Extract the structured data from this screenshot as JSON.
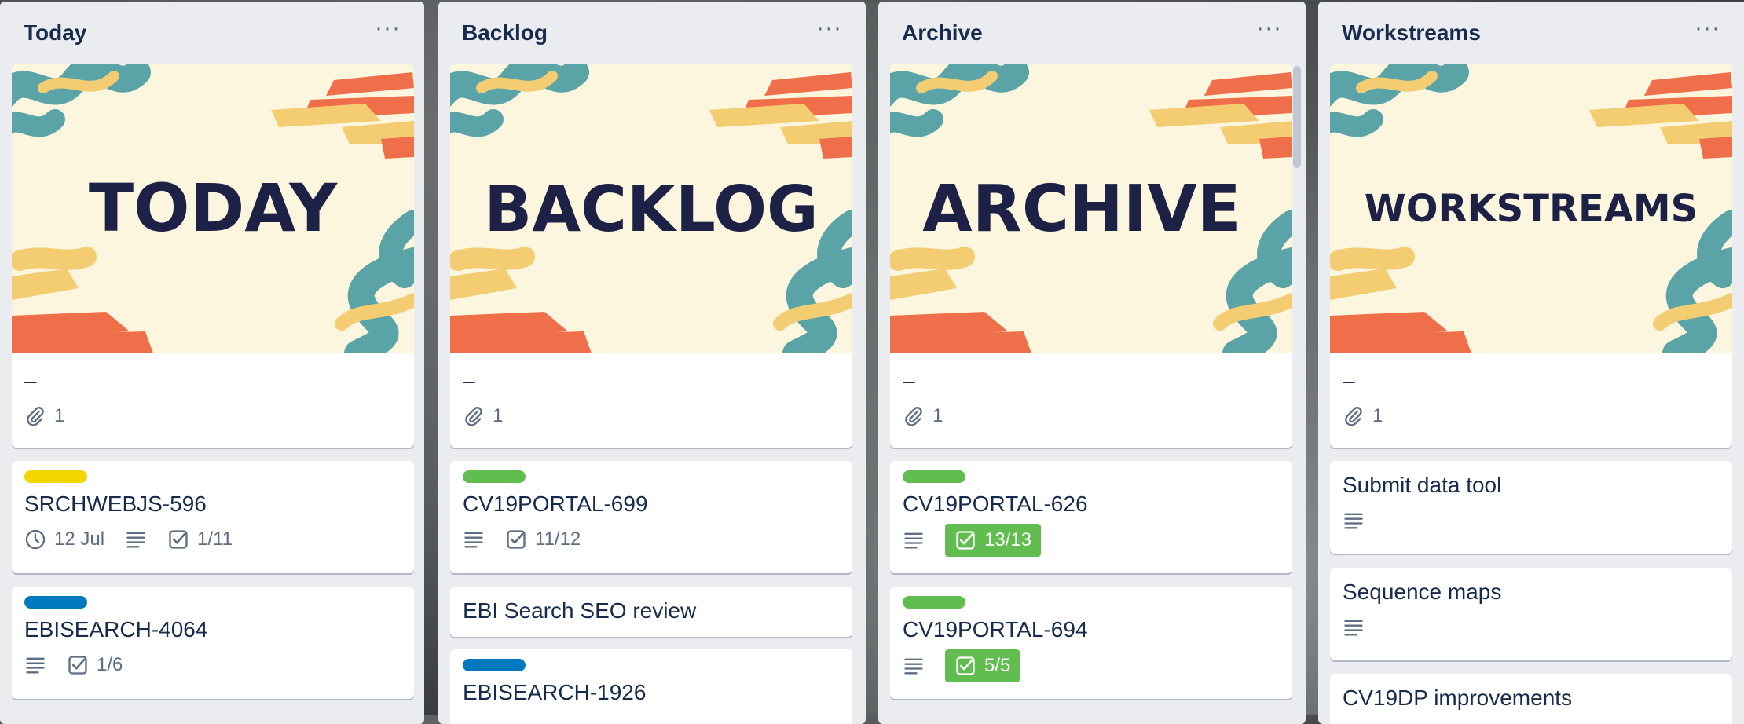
{
  "colors": {
    "label_yellow": "#f2d600",
    "label_green": "#61bd4f",
    "label_blue": "#0079bf",
    "list_bg": "#ebecf0",
    "text": "#172b4d"
  },
  "lists": [
    {
      "title": "Today",
      "menu_label": "···",
      "cover_text": "TODAY",
      "cover_card": {
        "title": "–",
        "attachments": "1"
      },
      "cards": [
        {
          "label_color": "yellow",
          "title": "SRCHWEBJS-596",
          "due": "12 Jul",
          "has_description": true,
          "checklist": "1/11"
        },
        {
          "label_color": "blue",
          "title": "EBISEARCH-4064",
          "has_description": true,
          "checklist": "1/6"
        }
      ]
    },
    {
      "title": "Backlog",
      "menu_label": "···",
      "cover_text": "BACKLOG",
      "cover_card": {
        "title": "–",
        "attachments": "1"
      },
      "cards": [
        {
          "label_color": "green",
          "title": "CV19PORTAL-699",
          "has_description": true,
          "checklist": "11/12"
        },
        {
          "title": "EBI Search SEO review"
        },
        {
          "label_color": "blue",
          "title": "EBISEARCH-1926"
        }
      ]
    },
    {
      "title": "Archive",
      "menu_label": "···",
      "cover_text": "ARCHIVE",
      "cover_card": {
        "title": "–",
        "attachments": "1"
      },
      "cards": [
        {
          "label_color": "green",
          "title": "CV19PORTAL-626",
          "has_description": true,
          "checklist": "13/13",
          "checklist_complete": true
        },
        {
          "label_color": "green",
          "title": "CV19PORTAL-694",
          "has_description": true,
          "checklist": "5/5",
          "checklist_complete": true
        }
      ]
    },
    {
      "title": "Workstreams",
      "menu_label": "···",
      "cover_text": "WORKSTREAMS",
      "cover_card": {
        "title": "–",
        "attachments": "1"
      },
      "cards": [
        {
          "title": "Submit data tool",
          "has_description": true
        },
        {
          "title": "Sequence maps",
          "has_description": true
        },
        {
          "title": "CV19DP improvements"
        }
      ]
    }
  ]
}
